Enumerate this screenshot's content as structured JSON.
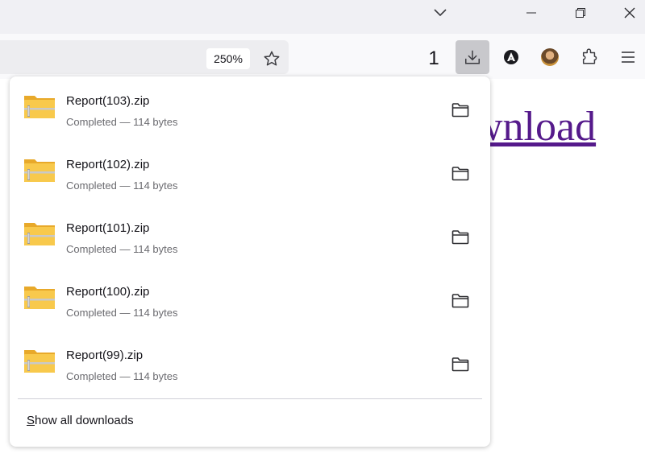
{
  "window": {
    "controls": [
      "chevron-down-icon",
      "minimize-icon",
      "restore-icon",
      "close-icon"
    ]
  },
  "toolbar": {
    "zoom_label": "250%",
    "download_count": "1",
    "icons": [
      "bookmark-star-icon",
      "downloads-icon",
      "acrobat-icon",
      "account-avatar",
      "extensions-icon",
      "menu-icon"
    ]
  },
  "page": {
    "link_text": "ownload"
  },
  "downloads": {
    "items": [
      {
        "name": "Report(103).zip",
        "status": "Completed — 114 bytes"
      },
      {
        "name": "Report(102).zip",
        "status": "Completed — 114 bytes"
      },
      {
        "name": "Report(101).zip",
        "status": "Completed — 114 bytes"
      },
      {
        "name": "Report(100).zip",
        "status": "Completed — 114 bytes"
      },
      {
        "name": "Report(99).zip",
        "status": "Completed — 114 bytes"
      }
    ],
    "show_all_prefix": "S",
    "show_all_rest": "how all downloads"
  },
  "colors": {
    "link": "#551a8b",
    "titlebar": "#f0f0f4",
    "active_button": "#c8c8cc",
    "folder_yellow": "#f8c94c"
  }
}
